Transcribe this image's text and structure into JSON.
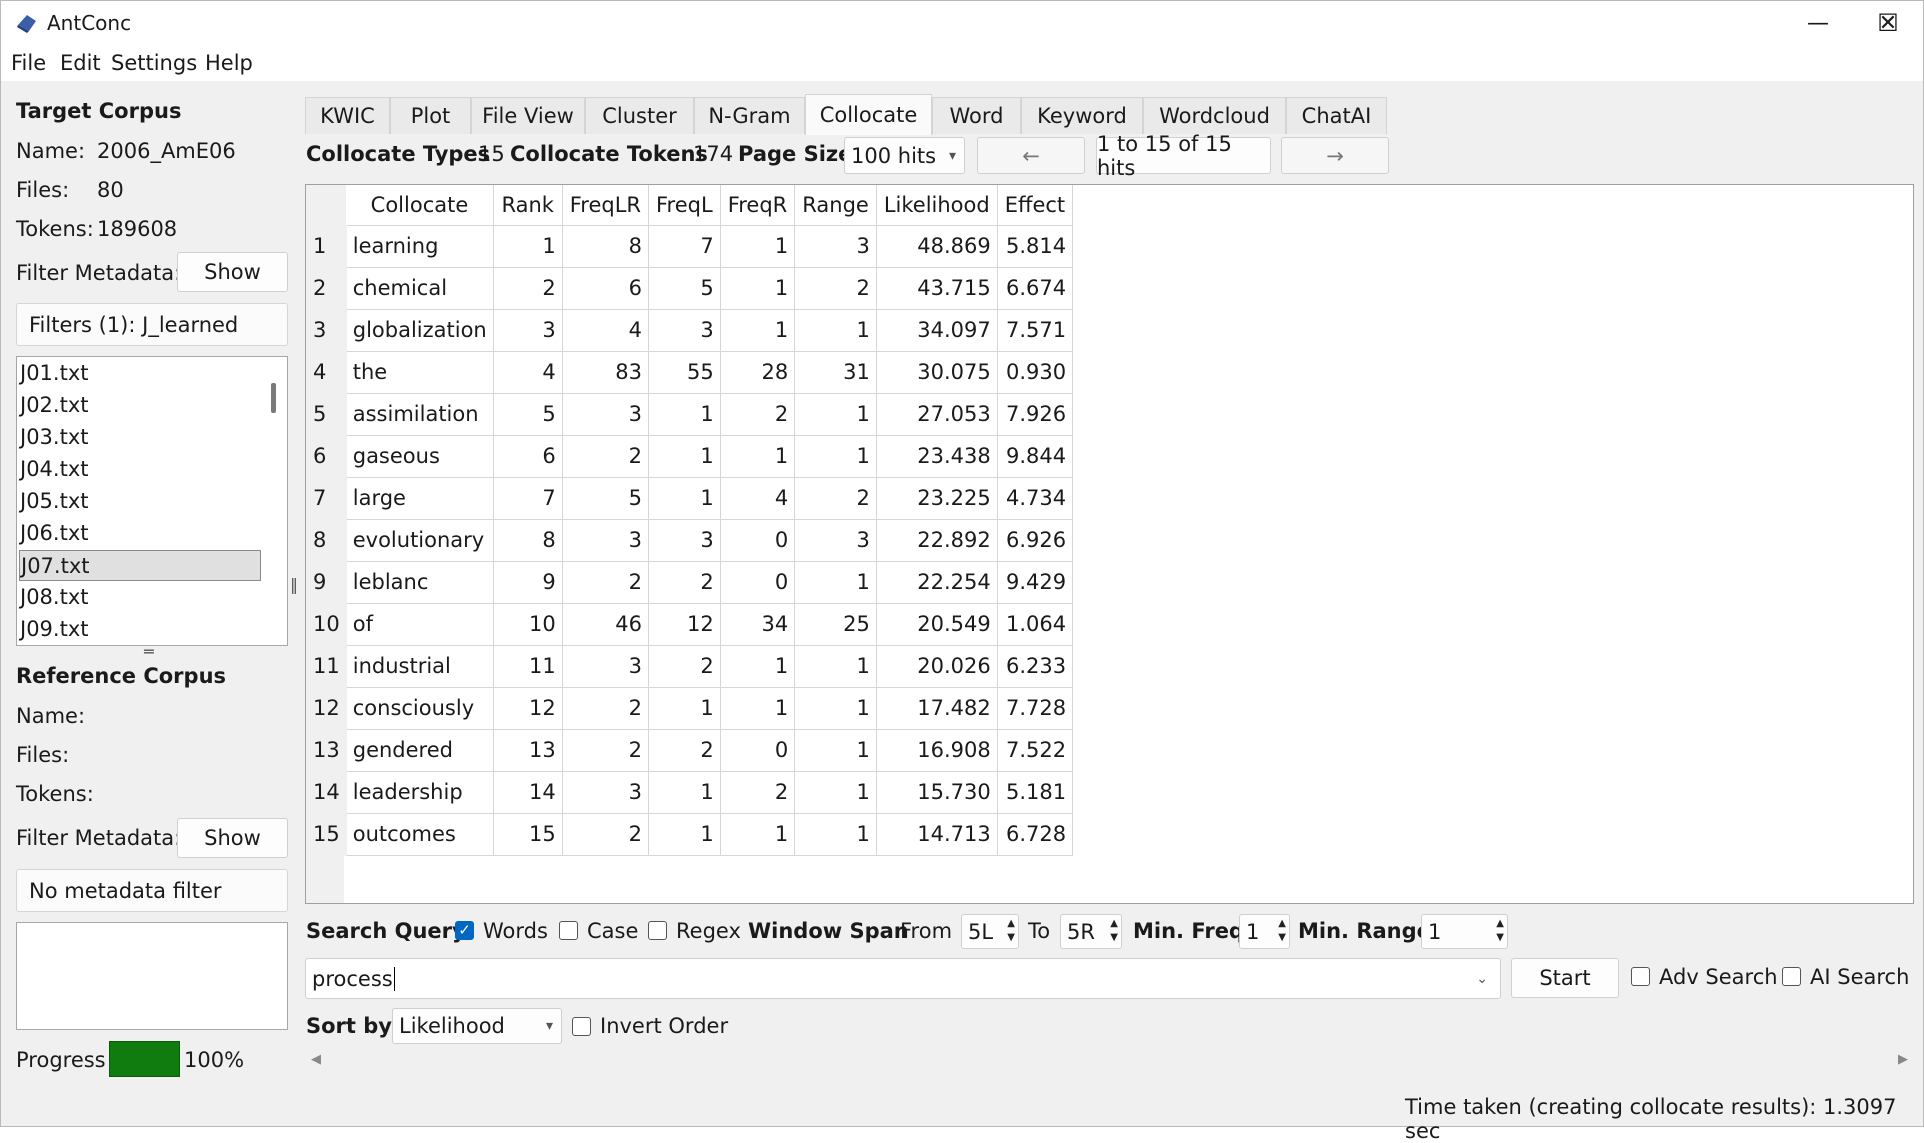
{
  "window": {
    "title": "AntConc",
    "minimize": "—",
    "maximize": "☐",
    "close": "✕"
  },
  "menu": [
    "File",
    "Edit",
    "Settings",
    "Help"
  ],
  "target": {
    "heading": "Target Corpus",
    "name_label": "Name:",
    "name": "2006_AmE06",
    "files_label": "Files:",
    "files": "80",
    "tokens_label": "Tokens:",
    "tokens": "189608",
    "filter_label": "Filter Metadata:",
    "show_button": "Show",
    "filters_text": "Filters (1): J_learned",
    "file_list": [
      "J01.txt",
      "J02.txt",
      "J03.txt",
      "J04.txt",
      "J05.txt",
      "J06.txt",
      "J07.txt",
      "J08.txt",
      "J09.txt"
    ],
    "selected_file": "J07.txt"
  },
  "reference": {
    "heading": "Reference Corpus",
    "name_label": "Name:",
    "files_label": "Files:",
    "tokens_label": "Tokens:",
    "filter_label": "Filter Metadata:",
    "show_button": "Show",
    "filter_text": "No metadata filter"
  },
  "progress": {
    "label": "Progress",
    "value": "100%",
    "fraction": 1.0
  },
  "tabs": [
    "KWIC",
    "Plot",
    "File View",
    "Cluster",
    "N-Gram",
    "Collocate",
    "Word",
    "Keyword",
    "Wordcloud",
    "ChatAI"
  ],
  "active_tab": "Collocate",
  "stats": {
    "types_label": "Collocate Types",
    "types": "15",
    "tokens_label": "Collocate Tokens",
    "tokens": "174",
    "page_size_label": "Page Size",
    "page_size": "100 hits",
    "prev": "←",
    "hits": "1 to 15 of 15 hits",
    "next": "→"
  },
  "table": {
    "columns": [
      "Collocate",
      "Rank",
      "FreqLR",
      "FreqL",
      "FreqR",
      "Range",
      "Likelihood",
      "Effect"
    ],
    "rows": [
      [
        "1",
        "learning",
        "1",
        "8",
        "7",
        "1",
        "3",
        "48.869",
        "5.814"
      ],
      [
        "2",
        "chemical",
        "2",
        "6",
        "5",
        "1",
        "2",
        "43.715",
        "6.674"
      ],
      [
        "3",
        "globalization",
        "3",
        "4",
        "3",
        "1",
        "1",
        "34.097",
        "7.571"
      ],
      [
        "4",
        "the",
        "4",
        "83",
        "55",
        "28",
        "31",
        "30.075",
        "0.930"
      ],
      [
        "5",
        "assimilation",
        "5",
        "3",
        "1",
        "2",
        "1",
        "27.053",
        "7.926"
      ],
      [
        "6",
        "gaseous",
        "6",
        "2",
        "1",
        "1",
        "1",
        "23.438",
        "9.844"
      ],
      [
        "7",
        "large",
        "7",
        "5",
        "1",
        "4",
        "2",
        "23.225",
        "4.734"
      ],
      [
        "8",
        "evolutionary",
        "8",
        "3",
        "3",
        "0",
        "3",
        "22.892",
        "6.926"
      ],
      [
        "9",
        "leblanc",
        "9",
        "2",
        "2",
        "0",
        "1",
        "22.254",
        "9.429"
      ],
      [
        "10",
        "of",
        "10",
        "46",
        "12",
        "34",
        "25",
        "20.549",
        "1.064"
      ],
      [
        "11",
        "industrial",
        "11",
        "3",
        "2",
        "1",
        "1",
        "20.026",
        "6.233"
      ],
      [
        "12",
        "consciously",
        "12",
        "2",
        "1",
        "1",
        "1",
        "17.482",
        "7.728"
      ],
      [
        "13",
        "gendered",
        "13",
        "2",
        "2",
        "0",
        "1",
        "16.908",
        "7.522"
      ],
      [
        "14",
        "leadership",
        "14",
        "3",
        "1",
        "2",
        "1",
        "15.730",
        "5.181"
      ],
      [
        "15",
        "outcomes",
        "15",
        "2",
        "1",
        "1",
        "1",
        "14.713",
        "6.728"
      ]
    ]
  },
  "search": {
    "query_label": "Search Query",
    "words": "Words",
    "words_checked": true,
    "case": "Case",
    "regex": "Regex",
    "window_span_label": "Window Span",
    "from_label": "From",
    "from_value": "5L",
    "to_label": "To",
    "to_value": "5R",
    "min_freq_label": "Min. Freq",
    "min_freq": "1",
    "min_range_label": "Min. Range",
    "min_range": "1",
    "query": "process",
    "start": "Start",
    "adv_search": "Adv Search",
    "ai_search": "AI Search",
    "sort_label": "Sort by",
    "sort_value": "Likelihood",
    "invert_order": "Invert Order"
  },
  "status": {
    "text": "Time taken (creating collocate results):  1.3097 sec"
  }
}
